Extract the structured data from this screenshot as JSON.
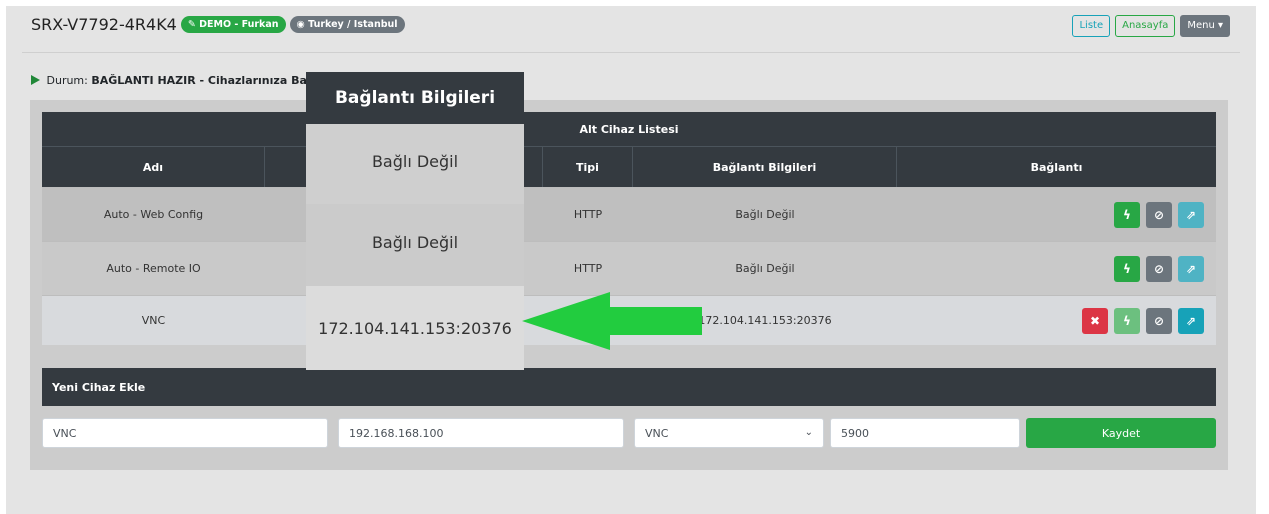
{
  "header": {
    "device_id": "SRX-V7792-4R4K4",
    "demo_badge": "✎ DEMO - Furkan",
    "location_badge": "◉ Turkey / Istanbul",
    "buttons": {
      "liste": "Liste",
      "anasayfa": "Anasayfa",
      "menu": "Menu ▾"
    }
  },
  "status": {
    "label": "Durum:",
    "value": "BAĞLANTI HAZIR - Cihazlarınıza Bağl"
  },
  "table": {
    "caption": "Alt Cihaz Listesi",
    "headers": {
      "name": "Adı",
      "type": "Tipi",
      "connection_info": "Bağlantı Bilgileri",
      "connection": "Bağlantı"
    },
    "rows": [
      {
        "name": "Auto - Web Config",
        "type": "HTTP",
        "info": "Bağlı Değil"
      },
      {
        "name": "Auto - Remote IO",
        "type": "HTTP",
        "info": "Bağlı Değil"
      },
      {
        "name": "VNC",
        "type": "",
        "info": "172.104.141.153:20376"
      }
    ]
  },
  "new_device": {
    "title": "Yeni Cihaz Ekle",
    "name_value": "VNC",
    "ip_value": "192.168.168.100",
    "type_value": "VNC",
    "port_value": "5900",
    "save_label": "Kaydet"
  },
  "overlay": {
    "title": "Bağlantı Bilgileri",
    "cells": [
      "Bağlı Değil",
      "Bağlı Değil",
      "172.104.141.153:20376"
    ]
  },
  "colors": {
    "accent_green": "#28a745",
    "arrow_green": "#22cc3f",
    "dark": "#343a40",
    "danger": "#dc3545",
    "info": "#17a2b8"
  },
  "icons": {
    "connect": "bolt-icon",
    "disable": "ban-icon",
    "open": "external-link-icon",
    "delete": "close-icon"
  }
}
